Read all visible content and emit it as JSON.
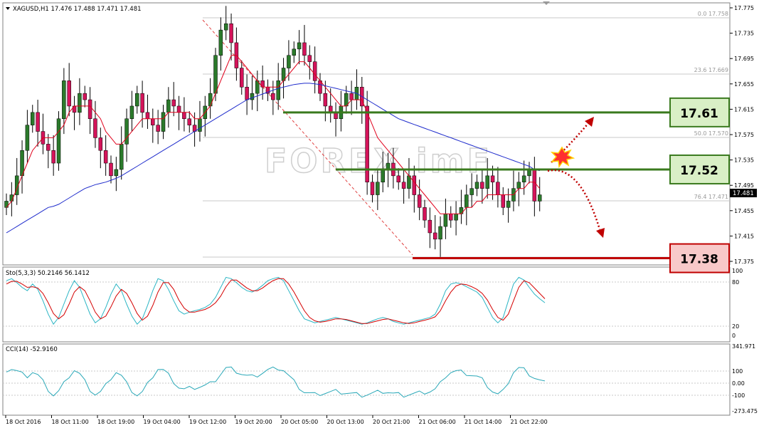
{
  "header": {
    "symbol_line": "XAGUSD,H1  17.476 17.488 17.471 17.481"
  },
  "price_axis": {
    "ticks": [
      "17.775",
      "17.735",
      "17.695",
      "17.655",
      "17.615",
      "17.575",
      "17.535",
      "17.495",
      "17.455",
      "17.415",
      "17.375"
    ],
    "current_label": "17.481"
  },
  "fib_labels": [
    "0.0  17.758",
    "23.6  17.669",
    "50.0  17.570",
    "76.4  17.471"
  ],
  "levels": [
    {
      "label": "17.61",
      "value": 17.61,
      "line_color": "#3a7a1e",
      "box_fill": "#d9efc6",
      "box_stroke": "#3a7a1e"
    },
    {
      "label": "17.52",
      "value": 17.52,
      "line_color": "#3a7a1e",
      "box_fill": "#d9efc6",
      "box_stroke": "#3a7a1e"
    },
    {
      "label": "17.38",
      "value": 17.38,
      "line_color": "#c00000",
      "box_fill": "#f8c9c9",
      "box_stroke": "#c00000"
    }
  ],
  "watermark": "FOREX imF",
  "stoch": {
    "label": "Sto(5,3,3) 50.2146 56.1412",
    "ticks": [
      "100",
      "80",
      "20",
      "0"
    ]
  },
  "cci": {
    "label": "CCI(14) -52.9160",
    "ticks": [
      "341.971",
      "100",
      "0.00",
      "-100",
      "-273.475"
    ]
  },
  "time_axis": [
    "18 Oct 2016",
    "18 Oct 11:00",
    "18 Oct 19:00",
    "19 Oct 04:00",
    "19 Oct 12:00",
    "19 Oct 20:00",
    "20 Oct 05:00",
    "20 Oct 13:00",
    "20 Oct 21:00",
    "21 Oct 06:00",
    "21 Oct 14:00",
    "21 Oct 22:00"
  ],
  "colors": {
    "bull": "#2b7a2b",
    "bear": "#d4145a",
    "ma_fast": "#e0001b",
    "ma_slow": "#1f2ccc",
    "stoch_main": "#2bb5c4",
    "stoch_signal": "#d40000",
    "cci": "#2aa8b8"
  },
  "chart_data": {
    "type": "candlestick",
    "instrument": "XAGUSD",
    "timeframe": "H1",
    "ylim": [
      17.375,
      17.775
    ],
    "close": [
      17.47,
      17.48,
      17.51,
      17.55,
      17.59,
      17.61,
      17.58,
      17.56,
      17.55,
      17.53,
      17.6,
      17.66,
      17.62,
      17.61,
      17.64,
      17.63,
      17.6,
      17.57,
      17.55,
      17.53,
      17.51,
      17.52,
      17.56,
      17.6,
      17.62,
      17.64,
      17.61,
      17.6,
      17.59,
      17.58,
      17.61,
      17.63,
      17.62,
      17.61,
      17.6,
      17.59,
      17.58,
      17.6,
      17.62,
      17.64,
      17.7,
      17.74,
      17.75,
      17.72,
      17.68,
      17.65,
      17.63,
      17.64,
      17.66,
      17.65,
      17.64,
      17.63,
      17.66,
      17.68,
      17.7,
      17.71,
      17.72,
      17.7,
      17.69,
      17.66,
      17.64,
      17.62,
      17.61,
      17.6,
      17.62,
      17.64,
      17.63,
      17.65,
      17.62,
      17.5,
      17.48,
      17.5,
      17.52,
      17.53,
      17.51,
      17.5,
      17.49,
      17.51,
      17.48,
      17.46,
      17.44,
      17.42,
      17.41,
      17.43,
      17.45,
      17.44,
      17.45,
      17.46,
      17.48,
      17.49,
      17.5,
      17.49,
      17.51,
      17.5,
      17.48,
      17.46,
      17.47,
      17.49,
      17.5,
      17.51,
      17.52,
      17.47,
      17.48
    ],
    "ma_fast": [
      17.46,
      17.47,
      17.49,
      17.51,
      17.53,
      17.55,
      17.56,
      17.57,
      17.57,
      17.57,
      17.58,
      17.59,
      17.61,
      17.62,
      17.62,
      17.62,
      17.62,
      17.61,
      17.6,
      17.58,
      17.57,
      17.56,
      17.56,
      17.57,
      17.58,
      17.59,
      17.6,
      17.6,
      17.6,
      17.6,
      17.6,
      17.61,
      17.61,
      17.61,
      17.61,
      17.61,
      17.6,
      17.6,
      17.61,
      17.62,
      17.64,
      17.66,
      17.68,
      17.7,
      17.7,
      17.69,
      17.68,
      17.67,
      17.66,
      17.65,
      17.65,
      17.65,
      17.65,
      17.66,
      17.67,
      17.68,
      17.69,
      17.69,
      17.68,
      17.67,
      17.66,
      17.65,
      17.64,
      17.63,
      17.62,
      17.62,
      17.63,
      17.63,
      17.63,
      17.61,
      17.59,
      17.57,
      17.56,
      17.55,
      17.54,
      17.53,
      17.52,
      17.51,
      17.5,
      17.49,
      17.48,
      17.47,
      17.46,
      17.45,
      17.45,
      17.45,
      17.45,
      17.45,
      17.46,
      17.46,
      17.47,
      17.47,
      17.48,
      17.48,
      17.48,
      17.48,
      17.48,
      17.48,
      17.49,
      17.49,
      17.5,
      17.5,
      17.49
    ],
    "ma_slow": [
      17.42,
      17.425,
      17.43,
      17.435,
      17.44,
      17.445,
      17.45,
      17.455,
      17.46,
      17.462,
      17.465,
      17.47,
      17.475,
      17.48,
      17.485,
      17.49,
      17.493,
      17.496,
      17.498,
      17.5,
      17.503,
      17.506,
      17.51,
      17.515,
      17.52,
      17.525,
      17.53,
      17.535,
      17.54,
      17.545,
      17.55,
      17.555,
      17.56,
      17.565,
      17.57,
      17.575,
      17.58,
      17.585,
      17.59,
      17.595,
      17.6,
      17.605,
      17.61,
      17.615,
      17.62,
      17.625,
      17.63,
      17.633,
      17.636,
      17.639,
      17.642,
      17.645,
      17.648,
      17.65,
      17.652,
      17.654,
      17.655,
      17.656,
      17.656,
      17.655,
      17.654,
      17.652,
      17.65,
      17.648,
      17.646,
      17.644,
      17.642,
      17.64,
      17.635,
      17.63,
      17.625,
      17.62,
      17.615,
      17.61,
      17.605,
      17.6,
      17.597,
      17.594,
      17.591,
      17.588,
      17.585,
      17.582,
      17.579,
      17.576,
      17.573,
      17.57,
      17.567,
      17.564,
      17.561,
      17.558,
      17.555,
      17.552,
      17.549,
      17.546,
      17.543,
      17.54,
      17.537,
      17.534,
      17.531,
      17.528,
      17.525,
      17.52,
      17.518
    ],
    "stoch_main": [
      85,
      88,
      82,
      75,
      70,
      80,
      72,
      55,
      35,
      20,
      30,
      50,
      70,
      85,
      75,
      55,
      35,
      22,
      28,
      45,
      65,
      80,
      70,
      50,
      32,
      20,
      28,
      48,
      70,
      88,
      85,
      72,
      55,
      40,
      35,
      38,
      40,
      42,
      45,
      50,
      60,
      75,
      90,
      88,
      82,
      75,
      70,
      68,
      72,
      78,
      85,
      88,
      90,
      85,
      70,
      55,
      40,
      28,
      25,
      22,
      24,
      26,
      28,
      30,
      28,
      26,
      24,
      22,
      20,
      22,
      25,
      28,
      30,
      28,
      24,
      22,
      20,
      22,
      24,
      26,
      28,
      30,
      35,
      50,
      70,
      80,
      82,
      80,
      76,
      72,
      68,
      60,
      45,
      30,
      22,
      30,
      55,
      80,
      90,
      86,
      75,
      65,
      58,
      52
    ],
    "stoch_signal": [
      80,
      84,
      84,
      80,
      75,
      76,
      74,
      66,
      52,
      36,
      28,
      34,
      50,
      68,
      76,
      70,
      55,
      38,
      28,
      32,
      46,
      62,
      72,
      66,
      52,
      36,
      26,
      32,
      48,
      68,
      82,
      82,
      72,
      56,
      44,
      38,
      38,
      40,
      42,
      46,
      52,
      62,
      76,
      86,
      86,
      80,
      74,
      70,
      70,
      74,
      80,
      85,
      88,
      88,
      80,
      68,
      54,
      40,
      30,
      25,
      23,
      24,
      26,
      28,
      28,
      27,
      25,
      23,
      21,
      21,
      23,
      25,
      27,
      28,
      26,
      24,
      22,
      21,
      22,
      24,
      26,
      28,
      31,
      40,
      55,
      68,
      77,
      80,
      79,
      76,
      72,
      66,
      56,
      42,
      30,
      26,
      35,
      55,
      75,
      85,
      82,
      74,
      66,
      58
    ]
  }
}
